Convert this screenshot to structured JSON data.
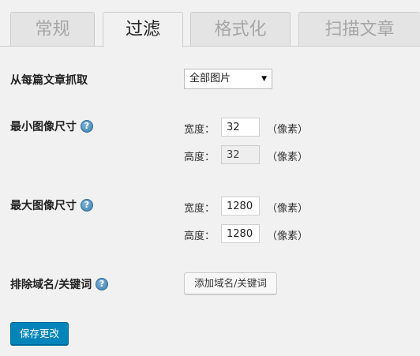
{
  "tabs": [
    {
      "label": "常规",
      "active": false
    },
    {
      "label": "过滤",
      "active": true
    },
    {
      "label": "格式化",
      "active": false
    },
    {
      "label": "扫描文章",
      "active": false
    }
  ],
  "fetch_from": {
    "label": "从每篇文章抓取",
    "selected": "全部图片"
  },
  "min_size": {
    "label": "最小图像尺寸",
    "width_label": "宽度：",
    "width_value": "32",
    "height_label": "高度：",
    "height_value": "32",
    "unit": "（像素）"
  },
  "max_size": {
    "label": "最大图像尺寸",
    "width_label": "宽度：",
    "width_value": "1280",
    "height_label": "高度：",
    "height_value": "1280",
    "unit": "（像素）"
  },
  "exclude": {
    "label": "排除域名/关键词",
    "button": "添加域名/关键词"
  },
  "help_glyph": "?",
  "save_button": "保存更改"
}
